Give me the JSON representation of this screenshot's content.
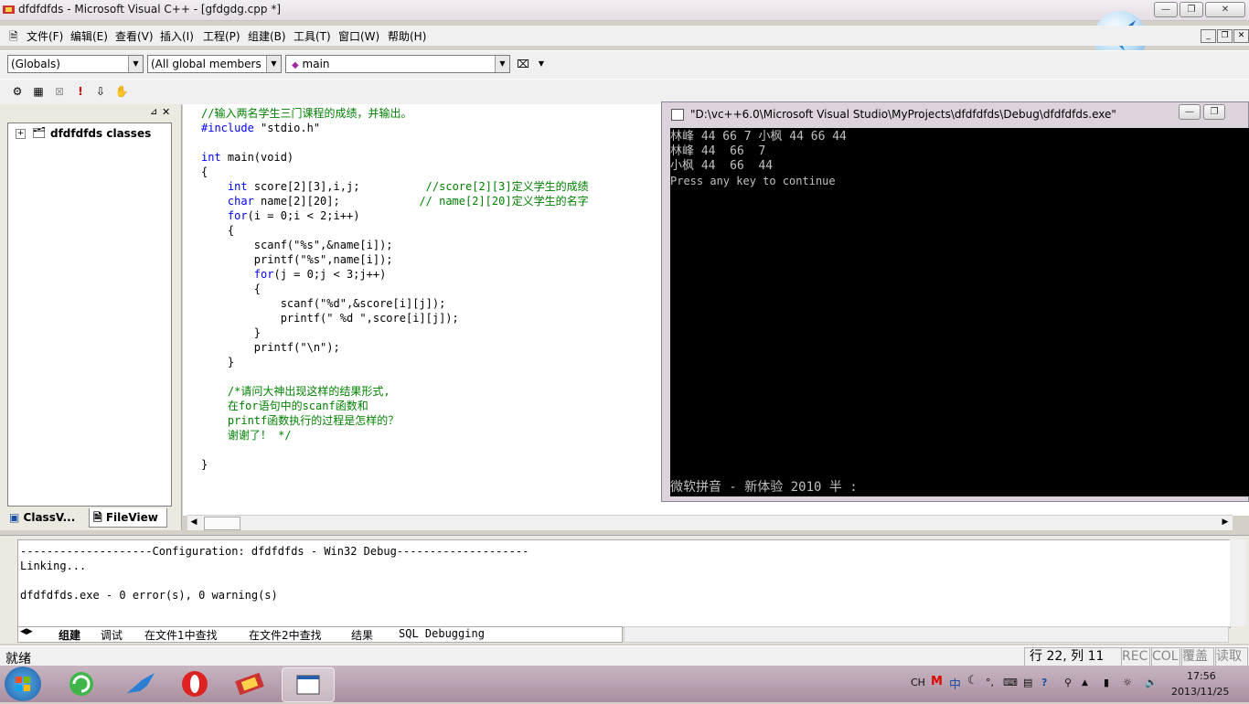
{
  "window": {
    "title": "dfdfdfds - Microsoft Visual C++ - [gfdgdg.cpp *]",
    "controls": {
      "minimize": "—",
      "restore": "❐",
      "close": "✕"
    }
  },
  "menu": [
    "文件(F)",
    "编辑(E)",
    "查看(V)",
    "插入(I)",
    "工程(P)",
    "组建(B)",
    "工具(T)",
    "窗口(W)",
    "帮助(H)"
  ],
  "toolbar": {
    "class_combo": "(Globals)",
    "members_combo": "(All global members",
    "function_combo": "main"
  },
  "workspace": {
    "tree_root": "dfdfdfds classes",
    "tabs": [
      "ClassV...",
      "FileView"
    ]
  },
  "editor": {
    "lines": [
      {
        "parts": [
          {
            "t": "//输入两名学生三门课程的成绩，并输出。",
            "c": "cm"
          }
        ]
      },
      {
        "parts": [
          {
            "t": "#include",
            "c": "kw"
          },
          {
            "t": " \"stdio.h\"",
            "c": ""
          }
        ]
      },
      {
        "parts": [
          {
            "t": "",
            "c": ""
          }
        ]
      },
      {
        "parts": [
          {
            "t": "int",
            "c": "kw"
          },
          {
            "t": " main(void)",
            "c": ""
          }
        ]
      },
      {
        "parts": [
          {
            "t": "{",
            "c": ""
          }
        ]
      },
      {
        "parts": [
          {
            "t": "    ",
            "c": ""
          },
          {
            "t": "int",
            "c": "kw"
          },
          {
            "t": " score[2][3],i,j;          ",
            "c": ""
          },
          {
            "t": "//score[2][3]定义学生的成绩",
            "c": "cm"
          }
        ]
      },
      {
        "parts": [
          {
            "t": "    ",
            "c": ""
          },
          {
            "t": "char",
            "c": "kw"
          },
          {
            "t": " name[2][20];            ",
            "c": ""
          },
          {
            "t": "// name[2][20]定义学生的名字",
            "c": "cm"
          }
        ]
      },
      {
        "parts": [
          {
            "t": "    ",
            "c": ""
          },
          {
            "t": "for",
            "c": "kw"
          },
          {
            "t": "(i = 0;i < 2;i++)",
            "c": ""
          }
        ]
      },
      {
        "parts": [
          {
            "t": "    {",
            "c": ""
          }
        ]
      },
      {
        "parts": [
          {
            "t": "        scanf(\"%s\",&name[i]);",
            "c": ""
          }
        ]
      },
      {
        "parts": [
          {
            "t": "        printf(\"%s\",name[i]);",
            "c": ""
          }
        ]
      },
      {
        "parts": [
          {
            "t": "        ",
            "c": ""
          },
          {
            "t": "for",
            "c": "kw"
          },
          {
            "t": "(j = 0;j < 3;j++)",
            "c": ""
          }
        ]
      },
      {
        "parts": [
          {
            "t": "        {",
            "c": ""
          }
        ]
      },
      {
        "parts": [
          {
            "t": "            scanf(\"%d\",&score[i][j]);",
            "c": ""
          }
        ]
      },
      {
        "parts": [
          {
            "t": "            printf(\" %d \",score[i][j]);",
            "c": ""
          }
        ]
      },
      {
        "parts": [
          {
            "t": "        }",
            "c": ""
          }
        ]
      },
      {
        "parts": [
          {
            "t": "        printf(\"\\n\");",
            "c": ""
          }
        ]
      },
      {
        "parts": [
          {
            "t": "    }",
            "c": ""
          }
        ]
      },
      {
        "parts": [
          {
            "t": "",
            "c": ""
          }
        ]
      },
      {
        "parts": [
          {
            "t": "    /*请问大神出现这样的结果形式,",
            "c": "cm"
          }
        ]
      },
      {
        "parts": [
          {
            "t": "    在for语句中的scanf函数和",
            "c": "cm"
          }
        ]
      },
      {
        "parts": [
          {
            "t": "    printf函数执行的过程是怎样的？",
            "c": "cm"
          }
        ]
      },
      {
        "parts": [
          {
            "t": "    谢谢了！ */",
            "c": "cm"
          }
        ]
      },
      {
        "parts": [
          {
            "t": "",
            "c": ""
          }
        ]
      },
      {
        "parts": [
          {
            "t": "}",
            "c": ""
          }
        ]
      }
    ]
  },
  "console": {
    "title": "\"D:\\vc++6.0\\Microsoft Visual Studio\\MyProjects\\dfdfdfds\\Debug\\dfdfdfds.exe\"",
    "lines": [
      "林峰 44 66 7 小枫 44 66 44",
      "林峰 44  66  7",
      "小枫 44  66  44",
      "Press any key to continue"
    ],
    "ime_line": "微软拼音 - 新体验 2010 半 :"
  },
  "output": {
    "lines": [
      "--------------------Configuration: dfdfdfds - Win32 Debug--------------------",
      "Linking...",
      "",
      "dfdfdfds.exe - 0 error(s), 0 warning(s)"
    ],
    "tabs": [
      "组建",
      "调试",
      "在文件1中查找",
      "在文件2中查找",
      "结果",
      "SQL Debugging"
    ]
  },
  "status": {
    "ready": "就绪",
    "position": "行 22, 列 11",
    "indicators": [
      "REC",
      "COL",
      "覆盖",
      "读取"
    ]
  },
  "taskbar": {
    "tray_lang": "CH",
    "tray_ime": "中",
    "clock_time": "17:56",
    "clock_date": "2013/11/25"
  }
}
